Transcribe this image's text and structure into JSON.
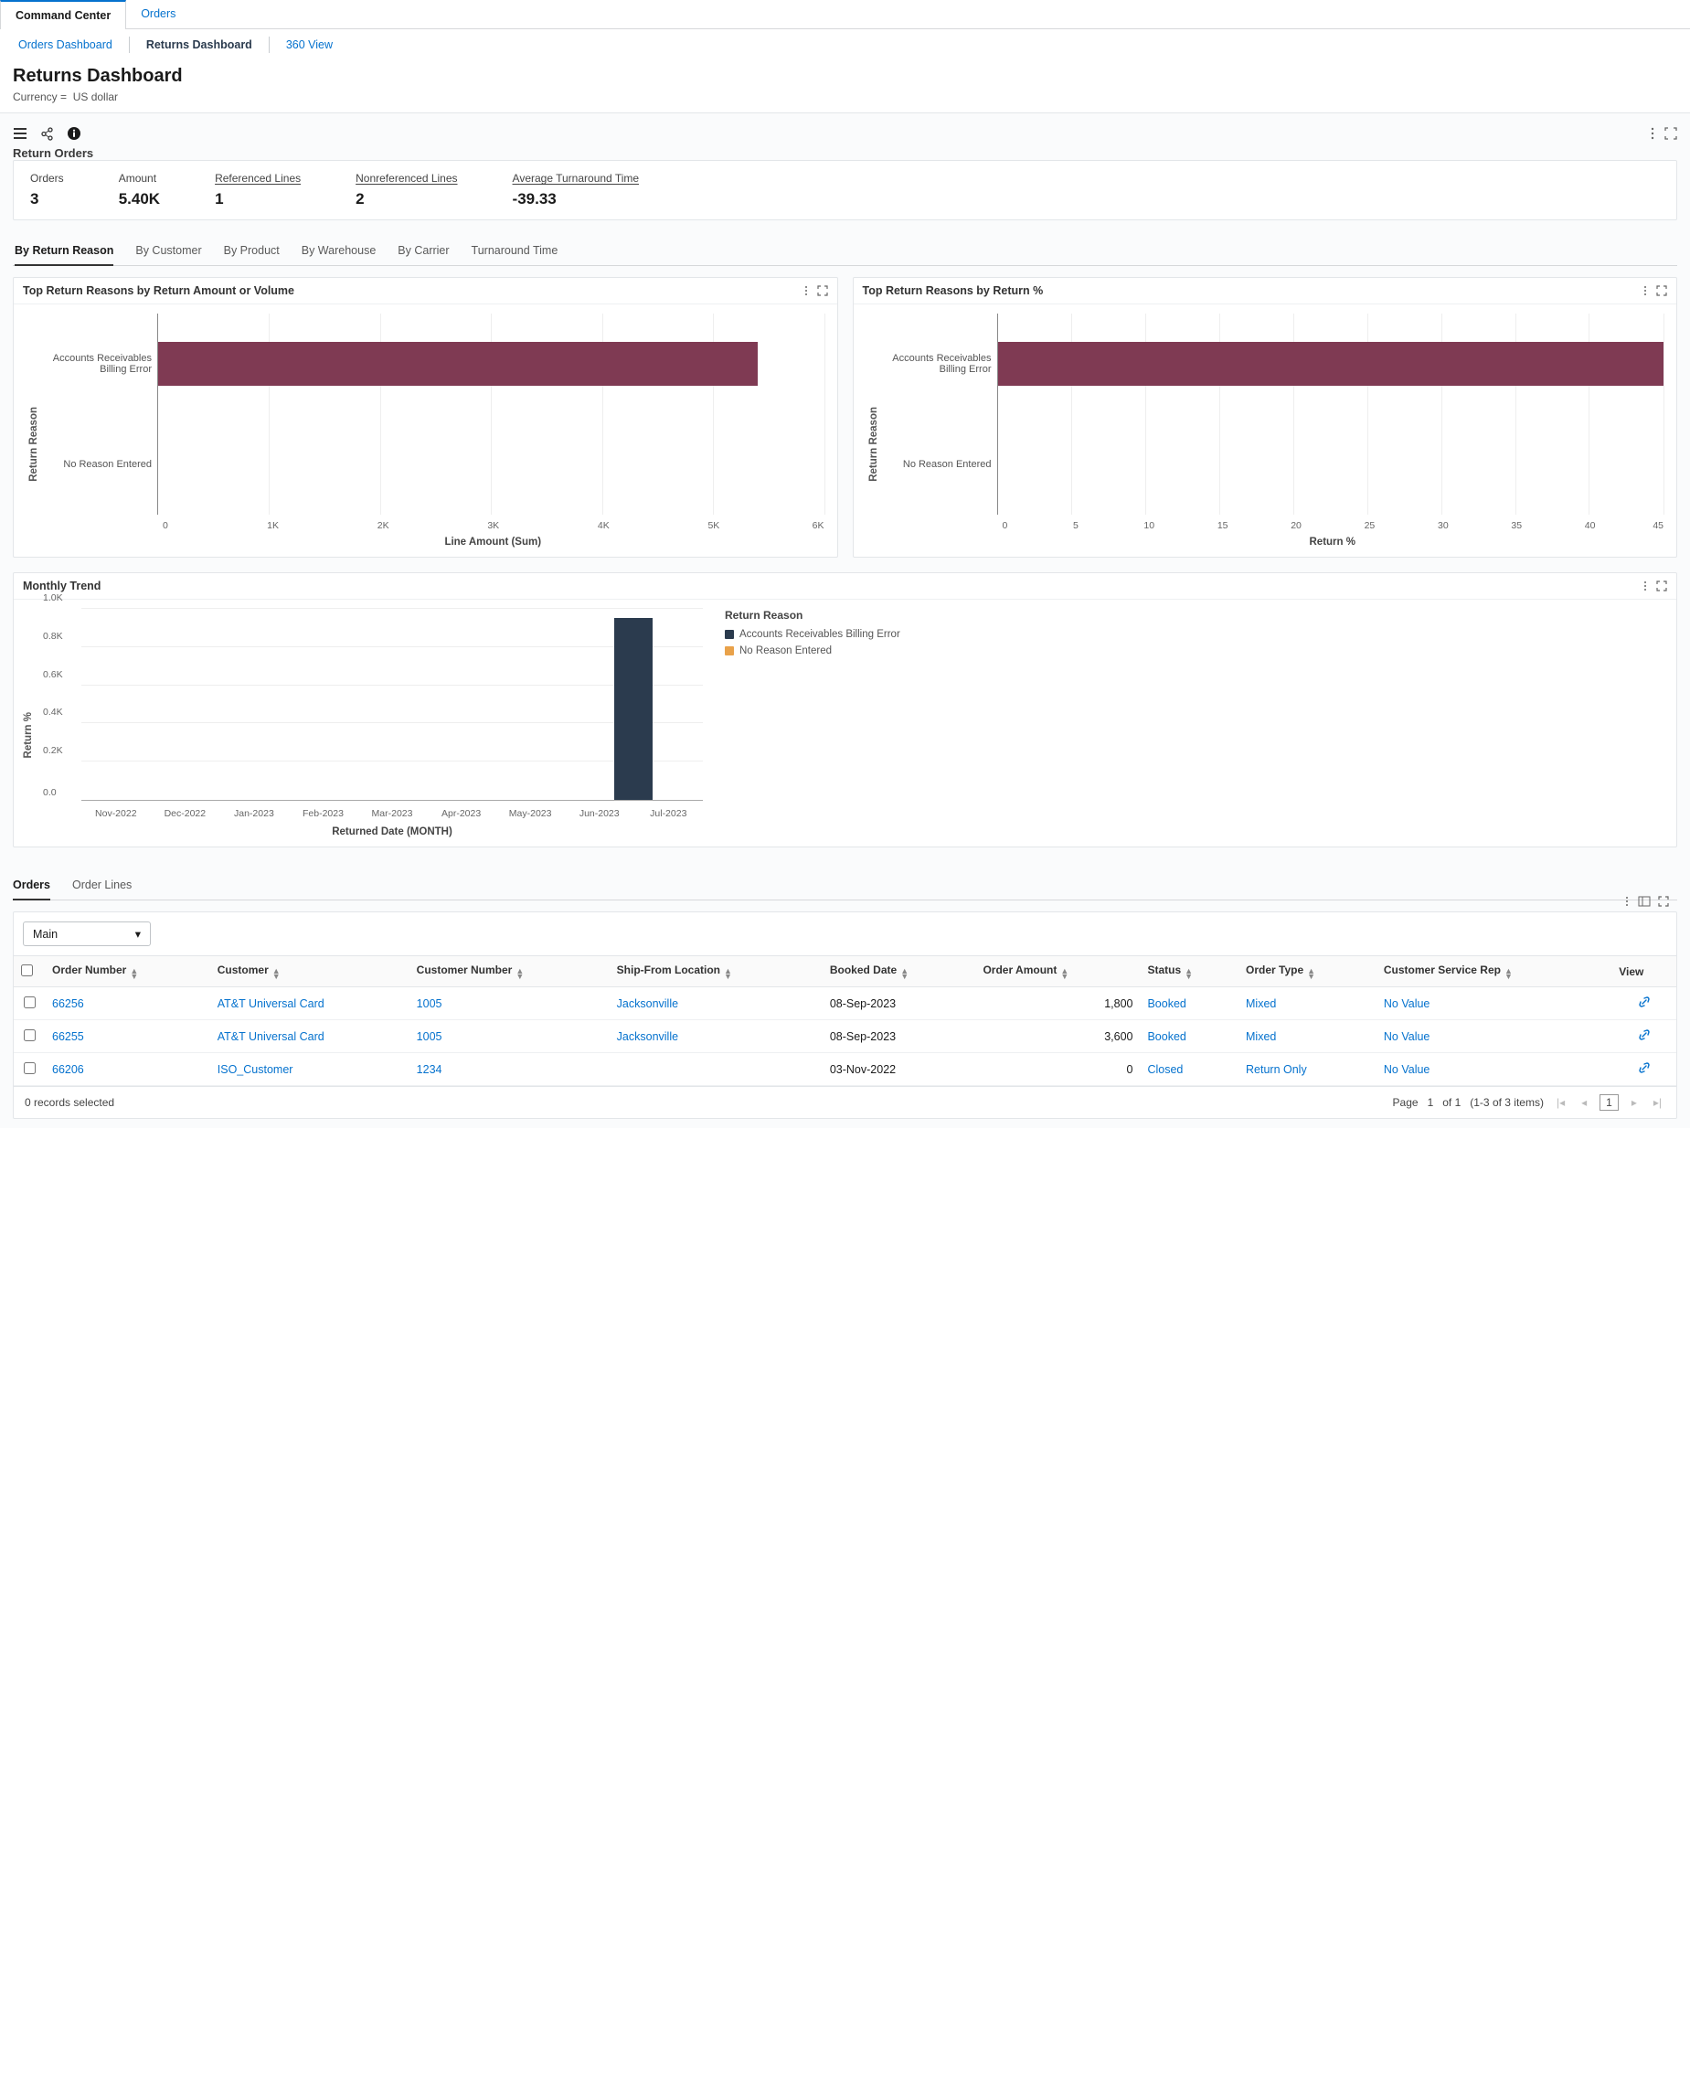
{
  "tabs_primary": {
    "items": [
      "Command Center",
      "Orders"
    ],
    "active": 0
  },
  "tabs_secondary": {
    "items": [
      "Orders Dashboard",
      "Returns Dashboard",
      "360 View"
    ],
    "active": 1
  },
  "page": {
    "title": "Returns Dashboard",
    "currency_label": "Currency =",
    "currency_value": "US dollar"
  },
  "panel": {
    "title": "Return Orders"
  },
  "kpis": {
    "orders": {
      "label": "Orders",
      "value": "3"
    },
    "amount": {
      "label": "Amount",
      "value": "5.40K"
    },
    "referenced": {
      "label": "Referenced Lines",
      "value": "1"
    },
    "nonreferenced": {
      "label": "Nonreferenced Lines",
      "value": "2"
    },
    "turnaround": {
      "label": "Average Turnaround Time",
      "value": "-39.33"
    }
  },
  "sub_tabs": [
    "By Return Reason",
    "By Customer",
    "By Product",
    "By Warehouse",
    "By Carrier",
    "Turnaround Time"
  ],
  "charts": {
    "left": {
      "title": "Top Return Reasons by Return Amount or Volume",
      "y_axis": "Return Reason",
      "x_axis": "Line Amount (Sum)",
      "categories": [
        "Accounts Receivables Billing Error",
        "No Reason Entered"
      ],
      "ticks": [
        "0",
        "1K",
        "2K",
        "3K",
        "4K",
        "5K",
        "6K"
      ]
    },
    "right": {
      "title": "Top Return Reasons by Return %",
      "y_axis": "Return Reason",
      "x_axis": "Return %",
      "categories": [
        "Accounts Receivables Billing Error",
        "No Reason Entered"
      ],
      "ticks": [
        "0",
        "5",
        "10",
        "15",
        "20",
        "25",
        "30",
        "35",
        "40",
        "45"
      ]
    },
    "trend": {
      "title": "Monthly Trend",
      "y_axis": "Return %",
      "x_axis": "Returned Date (MONTH)",
      "yticks": [
        "0.0",
        "0.2K",
        "0.4K",
        "0.6K",
        "0.8K",
        "1.0K"
      ],
      "xticks": [
        "Nov-2022",
        "Dec-2022",
        "Jan-2023",
        "Feb-2023",
        "Mar-2023",
        "Apr-2023",
        "May-2023",
        "Jun-2023",
        "Jul-2023"
      ],
      "legend_title": "Return Reason",
      "legend": [
        {
          "label": "Accounts Receivables Billing Error",
          "color": "#2b3b4e"
        },
        {
          "label": "No Reason Entered",
          "color": "#e9a24a"
        }
      ]
    }
  },
  "chart_data": [
    {
      "type": "bar",
      "orientation": "horizontal",
      "title": "Top Return Reasons by Return Amount or Volume",
      "xlabel": "Line Amount (Sum)",
      "ylabel": "Return Reason",
      "xlim": [
        0,
        6000
      ],
      "categories": [
        "Accounts Receivables Billing Error",
        "No Reason Entered"
      ],
      "values": [
        5400,
        0
      ]
    },
    {
      "type": "bar",
      "orientation": "horizontal",
      "title": "Top Return Reasons by Return %",
      "xlabel": "Return %",
      "ylabel": "Return Reason",
      "xlim": [
        0,
        45
      ],
      "categories": [
        "Accounts Receivables Billing Error",
        "No Reason Entered"
      ],
      "values": [
        45,
        0
      ]
    },
    {
      "type": "bar",
      "title": "Monthly Trend",
      "xlabel": "Returned Date (MONTH)",
      "ylabel": "Return %",
      "ylim": [
        0,
        1000
      ],
      "categories": [
        "Nov-2022",
        "Dec-2022",
        "Jan-2023",
        "Feb-2023",
        "Mar-2023",
        "Apr-2023",
        "May-2023",
        "Jun-2023",
        "Jul-2023"
      ],
      "series": [
        {
          "name": "Accounts Receivables Billing Error",
          "color": "#2b3b4e",
          "values": [
            0,
            0,
            0,
            0,
            0,
            0,
            0,
            0,
            950
          ]
        },
        {
          "name": "No Reason Entered",
          "color": "#e9a24a",
          "values": [
            0,
            0,
            0,
            0,
            0,
            0,
            0,
            0,
            0
          ]
        }
      ]
    }
  ],
  "orders_tabs": [
    "Orders",
    "Order Lines"
  ],
  "table": {
    "dropdown": "Main",
    "columns": [
      "Order Number",
      "Customer",
      "Customer Number",
      "Ship-From Location",
      "Booked Date",
      "Order Amount",
      "Status",
      "Order Type",
      "Customer Service Rep",
      "View"
    ],
    "rows": [
      {
        "order_number": "66256",
        "customer": "AT&T Universal Card",
        "customer_number": "1005",
        "ship_from": "Jacksonville",
        "booked": "08-Sep-2023",
        "amount": "1,800",
        "status": "Booked",
        "order_type": "Mixed",
        "csr": "No Value"
      },
      {
        "order_number": "66255",
        "customer": "AT&T Universal Card",
        "customer_number": "1005",
        "ship_from": "Jacksonville",
        "booked": "08-Sep-2023",
        "amount": "3,600",
        "status": "Booked",
        "order_type": "Mixed",
        "csr": "No Value"
      },
      {
        "order_number": "66206",
        "customer": "ISO_Customer",
        "customer_number": "1234",
        "ship_from": "",
        "booked": "03-Nov-2022",
        "amount": "0",
        "status": "Closed",
        "order_type": "Return Only",
        "csr": "No Value"
      }
    ],
    "footer": {
      "selected": "0 records selected",
      "page_label": "Page",
      "page_current": "1",
      "page_of": "of 1",
      "range": "(1-3 of 3 items)"
    }
  }
}
